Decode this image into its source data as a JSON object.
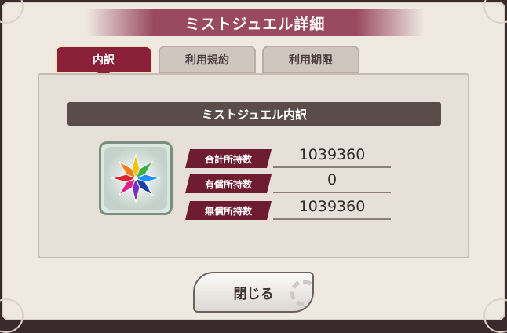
{
  "dialog": {
    "title": "ミストジュエル詳細",
    "tabs": [
      {
        "label": "内訳",
        "active": true
      },
      {
        "label": "利用規約",
        "active": false
      },
      {
        "label": "利用期限",
        "active": false
      }
    ],
    "section_title": "ミストジュエル内訳",
    "item_icon": "mist-jewel-icon",
    "rows": [
      {
        "label": "合計所持数",
        "value": "1039360"
      },
      {
        "label": "有償所持数",
        "value": "0"
      },
      {
        "label": "無償所持数",
        "value": "1039360"
      }
    ],
    "close_label": "閉じる"
  },
  "colors": {
    "accent": "#8a1f38",
    "header_bg": "#5a4c48",
    "title_band": "#9a4a60"
  }
}
